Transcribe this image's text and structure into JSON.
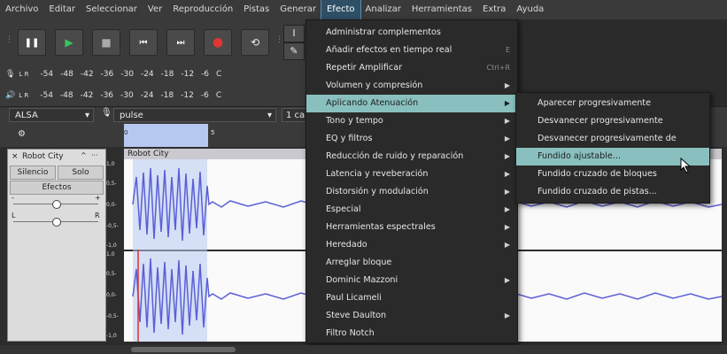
{
  "menubar": [
    "Archivo",
    "Editar",
    "Seleccionar",
    "Ver",
    "Reproducción",
    "Pistas",
    "Generar",
    "Efecto",
    "Analizar",
    "Herramientas",
    "Extra",
    "Ayuda"
  ],
  "transport": {
    "pause": "❚❚",
    "play": "▶",
    "stop": "■",
    "skip_start": "⏮",
    "skip_end": "⏭",
    "record": "●",
    "loop": "⟲"
  },
  "tools": {
    "select": "I",
    "draw": "✎"
  },
  "meters": {
    "rec": {
      "channels": "L R",
      "ticks": [
        "-54",
        "-48",
        "-42",
        "-36",
        "-30",
        "-24",
        "-18",
        "-12",
        "-6",
        "C"
      ]
    },
    "play": {
      "channels": "L R",
      "ticks": [
        "-54",
        "-48",
        "-42",
        "-36",
        "-30",
        "-24",
        "-18",
        "-12",
        "-6",
        "C"
      ]
    }
  },
  "device": {
    "host": "ALSA",
    "input": "pulse",
    "channels": "1 ca"
  },
  "ruler": {
    "ticks": [
      "0",
      "5"
    ]
  },
  "track": {
    "name": "Robot City",
    "clip_name": "Robot City",
    "mute": "Silencio",
    "solo": "Solo",
    "effects": "Efectos",
    "gain_minus": "-",
    "gain_plus": "+",
    "pan_left": "L",
    "pan_right": "R",
    "collapse": "^",
    "more": "···",
    "close": "×",
    "scale_top": [
      "1,0",
      "0,5-",
      "0,0-",
      "-0,5-",
      "-1,0"
    ],
    "scale_bottom": [
      "1,0",
      "0,5-",
      "0,0-",
      "-0,5-",
      "-1,0"
    ]
  },
  "menu": {
    "items": [
      {
        "label": "Administrar complementos",
        "shortcut": "",
        "arrow": false
      },
      {
        "label": "Añadir efectos en tiempo real",
        "shortcut": "E",
        "arrow": false
      },
      {
        "label": "Repetir Amplificar",
        "shortcut": "Ctrl+R",
        "arrow": false
      },
      {
        "label": "Volumen y compresión",
        "shortcut": "",
        "arrow": true
      },
      {
        "label": "Aplicando Atenuación",
        "shortcut": "",
        "arrow": true
      },
      {
        "label": "Tono y tempo",
        "shortcut": "",
        "arrow": true
      },
      {
        "label": "EQ y filtros",
        "shortcut": "",
        "arrow": true
      },
      {
        "label": "Reducción de ruido y reparación",
        "shortcut": "",
        "arrow": true
      },
      {
        "label": "Latencia y reveberación",
        "shortcut": "",
        "arrow": true
      },
      {
        "label": "Distorsión y modulación",
        "shortcut": "",
        "arrow": true
      },
      {
        "label": "Especial",
        "shortcut": "",
        "arrow": true
      },
      {
        "label": "Herramientas espectrales",
        "shortcut": "",
        "arrow": true
      },
      {
        "label": "Heredado",
        "shortcut": "",
        "arrow": true
      },
      {
        "label": "Arreglar bloque",
        "shortcut": "",
        "arrow": false
      },
      {
        "label": "Dominic Mazzoni",
        "shortcut": "",
        "arrow": true
      },
      {
        "label": "Paul Licameli",
        "shortcut": "",
        "arrow": false
      },
      {
        "label": "Steve Daulton",
        "shortcut": "",
        "arrow": true
      },
      {
        "label": "Filtro Notch",
        "shortcut": "",
        "arrow": false
      }
    ],
    "arrow_glyph": "▶"
  },
  "submenu": {
    "items": [
      "Aparecer progresivamente",
      "Desvanecer progresivamente",
      "Desvanecer progresivamente de estudio",
      "Fundido ajustable...",
      "Fundido cruzado de bloques",
      "Fundido cruzado de pistas..."
    ]
  },
  "colors": {
    "menu_highlight": "#89c0bf",
    "waveform": "#5a5fd6",
    "selection": "#b7c8f0",
    "playhead": "#e03030"
  }
}
